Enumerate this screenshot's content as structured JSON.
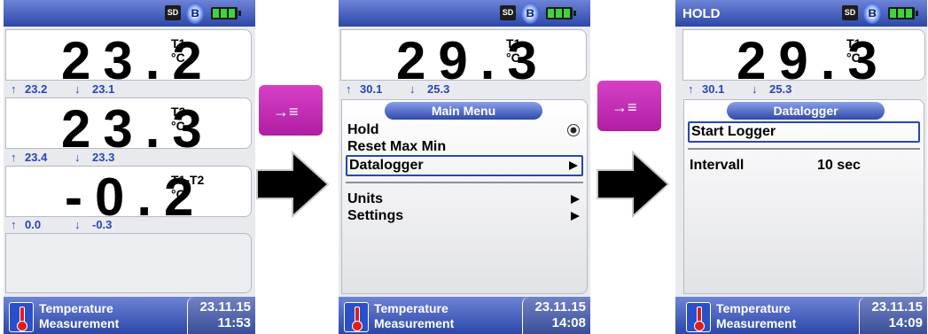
{
  "screen1": {
    "channels": [
      {
        "value": "23.2",
        "name": "T1",
        "unit": "°C",
        "max": "23.2",
        "min": "23.1"
      },
      {
        "value": "23.3",
        "name": "T2",
        "unit": "°C",
        "max": "23.4",
        "min": "23.3"
      },
      {
        "value": "-0.2",
        "name": "T1-T2",
        "unit": "°C",
        "max": "0.0",
        "min": "-0.3"
      }
    ],
    "measurement_line1": "Temperature",
    "measurement_line2": "Measurement",
    "date": "23.11.15",
    "time": "11:53"
  },
  "screen2": {
    "value": "29.3",
    "name": "T1",
    "unit": "°C",
    "max": "30.1",
    "min": "25.3",
    "menu_title": "Main Menu",
    "items": [
      "Hold",
      "Reset Max Min",
      "Datalogger",
      "Units",
      "Settings"
    ],
    "measurement_line1": "Temperature",
    "measurement_line2": "Measurement",
    "date": "23.11.15",
    "time": "14:08"
  },
  "screen3": {
    "status_title": "HOLD",
    "value": "29.3",
    "name": "T1",
    "unit": "°C",
    "max": "30.1",
    "min": "25.3",
    "menu_title": "Datalogger",
    "start_logger": "Start Logger",
    "interval_label": "Intervall",
    "interval_value": "10 sec",
    "measurement_line1": "Temperature",
    "measurement_line2": "Measurement",
    "date": "23.11.15",
    "time": "14:09"
  },
  "icons": {
    "sd": "SD",
    "bluetooth": "bluetooth-icon",
    "battery": "battery-icon",
    "thermometer": "thermometer-icon",
    "key": "→≡"
  },
  "colors": {
    "bar": "#2c47a8",
    "key": "#c028b4",
    "minmax": "#2746b8"
  }
}
